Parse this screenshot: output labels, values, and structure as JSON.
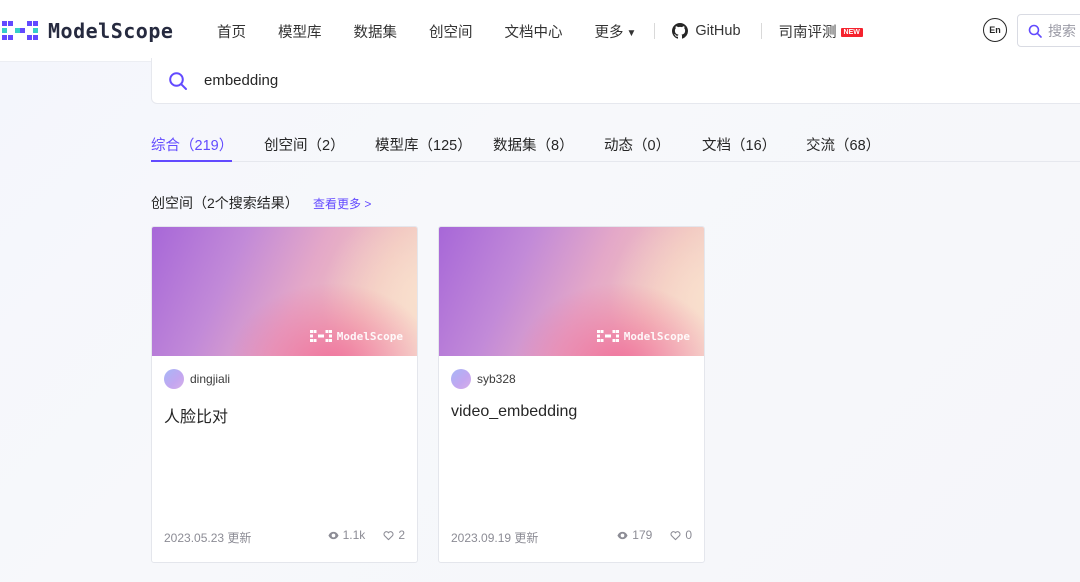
{
  "brand": {
    "name": "ModelScope"
  },
  "nav": {
    "items": [
      "首页",
      "模型库",
      "数据集",
      "创空间",
      "文档中心"
    ],
    "more": "更多",
    "github": "GitHub",
    "eval": "司南评测",
    "new_badge": "NEW"
  },
  "header": {
    "lang_label": "En",
    "search_placeholder": "搜索"
  },
  "search": {
    "query": "embedding"
  },
  "tabs": [
    {
      "label": "综合（219）",
      "active": true
    },
    {
      "label": "创空间（2）"
    },
    {
      "label": "模型库（125）"
    },
    {
      "label": "数据集（8）"
    },
    {
      "label": "动态（0）"
    },
    {
      "label": "文档（16）"
    },
    {
      "label": "交流（68）"
    }
  ],
  "section": {
    "title": "创空间（2个搜索结果）",
    "see_more": "查看更多 >"
  },
  "cards": [
    {
      "author": "dingjiali",
      "title": "人脸比对",
      "date": "2023.05.23 更新",
      "views": "1.1k",
      "likes": "2",
      "cover_logo": "ModelScope"
    },
    {
      "author": "syb328",
      "title": "video_embedding",
      "date": "2023.09.19 更新",
      "views": "179",
      "likes": "0",
      "cover_logo": "ModelScope"
    }
  ],
  "colors": {
    "accent": "#624aff",
    "badge_red": "#f5222d",
    "text": "#262626",
    "muted": "#8c8c95"
  },
  "icons": [
    "modelscope-logo-icon",
    "chevron-down-icon",
    "github-icon",
    "language-icon",
    "search-icon",
    "eye-icon",
    "heart-icon"
  ]
}
